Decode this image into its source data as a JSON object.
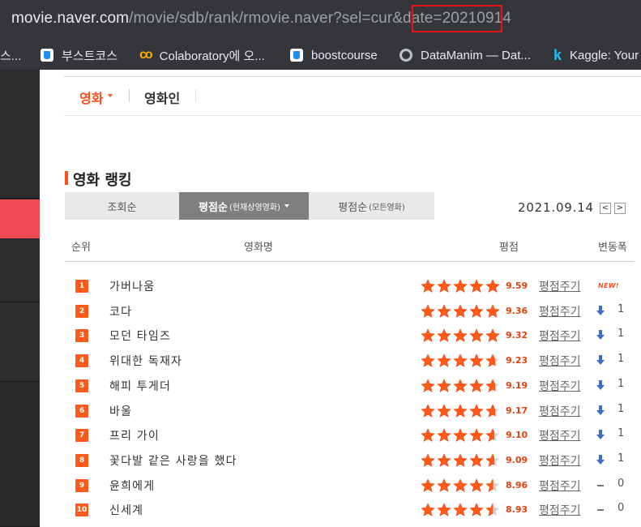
{
  "browser": {
    "url_host": "movie.naver.com",
    "url_path": "/movie/sdb/rank/rmovie.naver?sel=cur&date=",
    "url_date": "20210914",
    "bookmarks": [
      {
        "label": "스...",
        "icon": "none"
      },
      {
        "label": "부스트코스",
        "icon": "boostcourse-icon"
      },
      {
        "label": "Colaboratory에 오...",
        "icon": "colab-icon"
      },
      {
        "label": "boostcourse",
        "icon": "boostcourse-icon"
      },
      {
        "label": "DataManim — Dat...",
        "icon": "globe-icon"
      },
      {
        "label": "Kaggle: Your",
        "icon": "kaggle-icon"
      }
    ]
  },
  "nav": {
    "movie_tab": "영화",
    "person_tab": "영화인"
  },
  "ranking": {
    "title": "영화 랭킹",
    "tabs": [
      {
        "label": "조회순",
        "sub": ""
      },
      {
        "label": "평점순",
        "sub": "(현재상영영화)"
      },
      {
        "label": "평점순",
        "sub": "(모든영화)"
      }
    ],
    "date": "2021.09.14",
    "prev_label": "<",
    "next_label": ">",
    "columns": {
      "rank": "순위",
      "title": "영화명",
      "score": "평점",
      "change": "변동폭"
    },
    "rate_link_label": "평점주기",
    "new_label": "NEW!",
    "rows": [
      {
        "rank": "1",
        "title": "가버나움",
        "score": "9.59",
        "stars": 5,
        "change_type": "new",
        "change": ""
      },
      {
        "rank": "2",
        "title": "코다",
        "score": "9.36",
        "stars": 5,
        "change_type": "down",
        "change": "1"
      },
      {
        "rank": "3",
        "title": "모던 타임즈",
        "score": "9.32",
        "stars": 5,
        "change_type": "down",
        "change": "1"
      },
      {
        "rank": "4",
        "title": "위대한 독재자",
        "score": "9.23",
        "stars": 4.6,
        "change_type": "down",
        "change": "1"
      },
      {
        "rank": "5",
        "title": "해피 투게더",
        "score": "9.19",
        "stars": 4.6,
        "change_type": "down",
        "change": "1"
      },
      {
        "rank": "6",
        "title": "바울",
        "score": "9.17",
        "stars": 4.6,
        "change_type": "down",
        "change": "1"
      },
      {
        "rank": "7",
        "title": "프리 가이",
        "score": "9.10",
        "stars": 4.55,
        "change_type": "down",
        "change": "1"
      },
      {
        "rank": "8",
        "title": "꽃다발 같은 사랑을 했다",
        "score": "9.09",
        "stars": 4.55,
        "change_type": "down",
        "change": "1"
      },
      {
        "rank": "9",
        "title": "윤희에게",
        "score": "8.96",
        "stars": 4.48,
        "change_type": "same",
        "change": "0"
      },
      {
        "rank": "10",
        "title": "신세계",
        "score": "8.93",
        "stars": 4.47,
        "change_type": "same",
        "change": "0"
      }
    ]
  },
  "colors": {
    "accent": "#ff4f1a",
    "star_fill": "#ff5a1a",
    "star_empty": "#cfcfcf",
    "down_arrow": "#3a6fc4"
  }
}
